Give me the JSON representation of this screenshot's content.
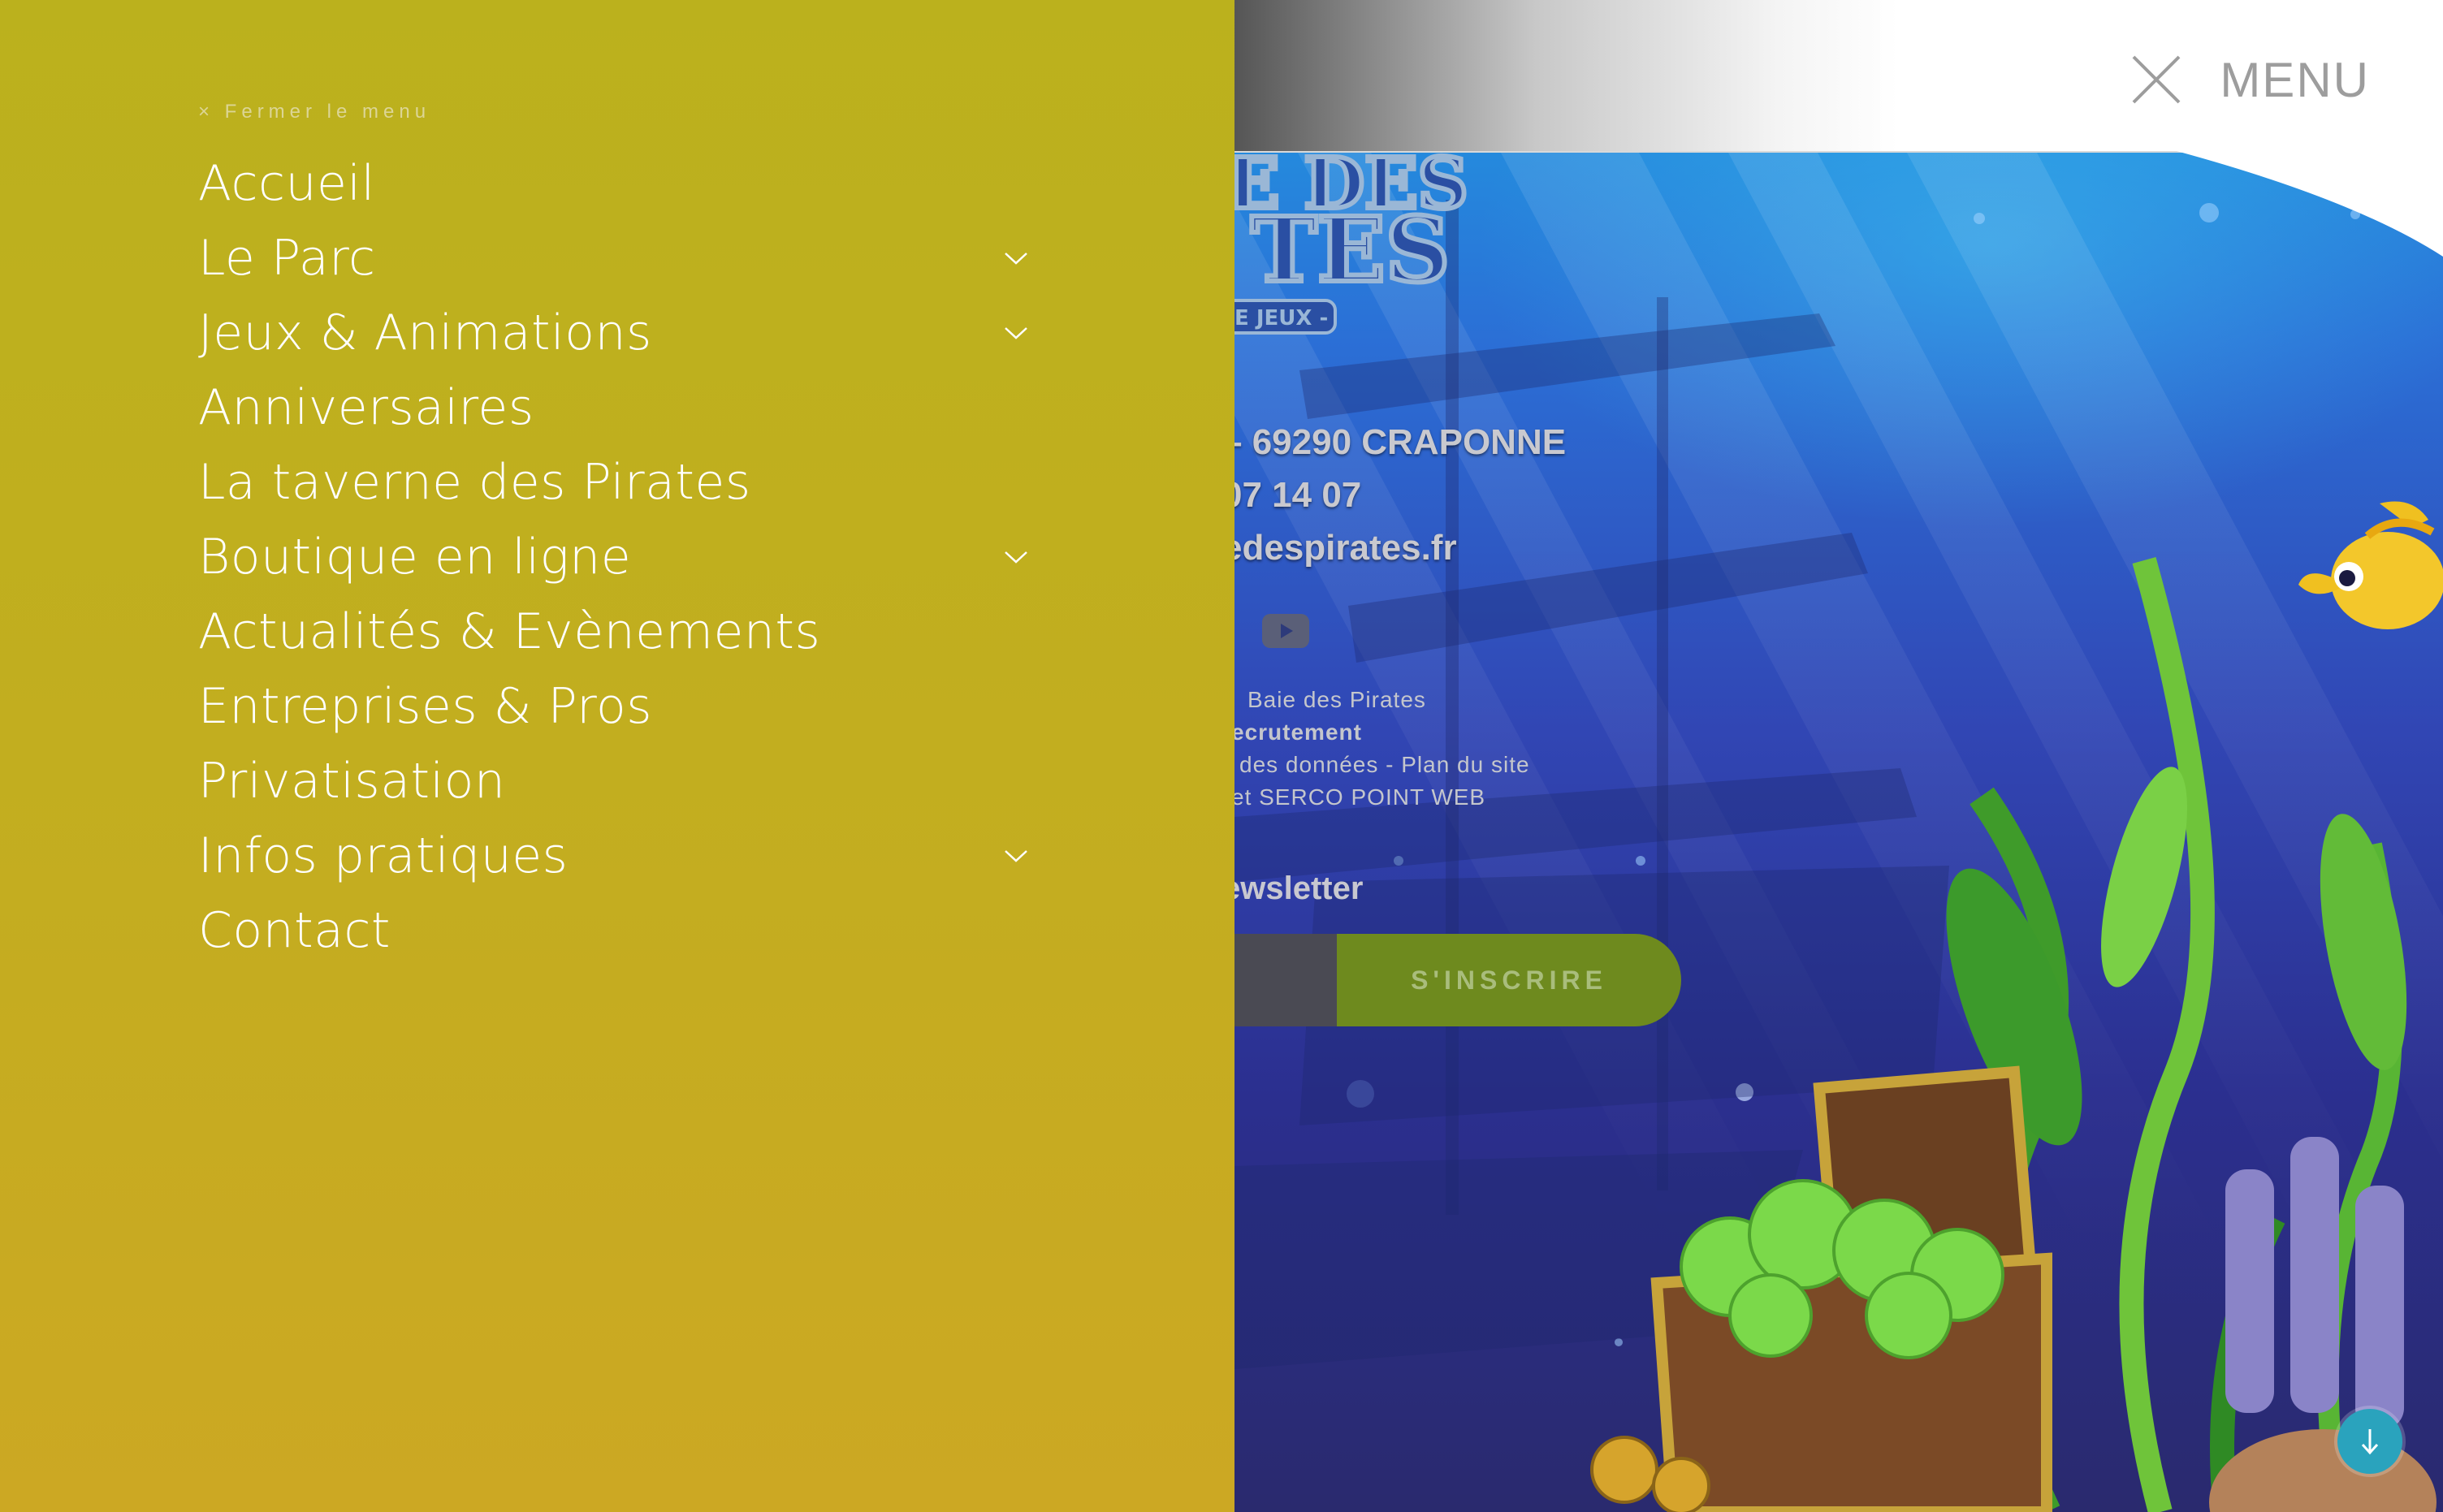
{
  "header": {
    "menu_label": "MENU"
  },
  "menu": {
    "close_label": "× Fermer le menu",
    "items": [
      {
        "label": "Accueil",
        "has_submenu": false
      },
      {
        "label": "Le Parc",
        "has_submenu": true
      },
      {
        "label": "Jeux & Animations",
        "has_submenu": true
      },
      {
        "label": "Anniversaires",
        "has_submenu": false
      },
      {
        "label": "La taverne des Pirates",
        "has_submenu": false
      },
      {
        "label": "Boutique en ligne",
        "has_submenu": true
      },
      {
        "label": "Actualités & Evènements",
        "has_submenu": false
      },
      {
        "label": "Entreprises & Pros",
        "has_submenu": false
      },
      {
        "label": "Privatisation",
        "has_submenu": false
      },
      {
        "label": "Infos pratiques",
        "has_submenu": true
      },
      {
        "label": "Contact",
        "has_submenu": false
      }
    ]
  },
  "footer": {
    "address": "– 69290 CRAPONNE",
    "phone": "07 14 07",
    "website": "edespirates.fr",
    "links": {
      "line1": "Baie des Pirates",
      "line2": "ecrutement",
      "line3": "des données - Plan du site",
      "line4": "et SERCO POINT WEB"
    },
    "newsletter_title": "ewsletter",
    "subscribe_label": "S'INSCRIRE"
  },
  "logo": {
    "text": "E DES",
    "text2": "TES",
    "tagline": "E JEUX -"
  },
  "colors": {
    "menu_panel": "#c2ae1f",
    "accent_button": "#6e8a1e",
    "scroll_button": "#2aa3bd"
  },
  "icons": [
    "close-icon",
    "chevron-down-icon",
    "youtube-icon",
    "arrow-down-icon"
  ]
}
